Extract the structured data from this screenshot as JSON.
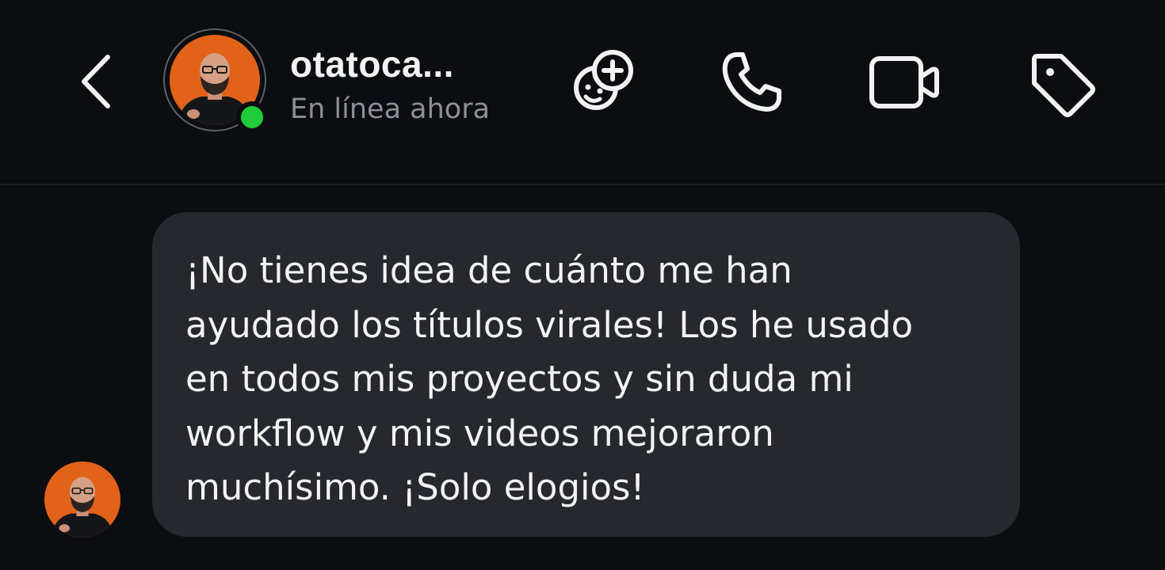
{
  "header": {
    "contact_name": "otatoca...",
    "status": "En línea ahora",
    "icons": {
      "back": "chevron-left-icon",
      "effects": "sticker-add-icon",
      "call": "phone-icon",
      "video": "video-camera-icon",
      "tag": "tag-icon"
    },
    "online_color": "#1fcb38"
  },
  "message": {
    "lines": [
      "¡No tienes idea de cuánto me han",
      "ayudado los títulos virales! Los he usado",
      "en todos mis proyectos y sin duda mi",
      "workflow y mis videos mejoraron",
      "muchísimo. ¡Solo elogios!"
    ]
  },
  "colors": {
    "background": "#0c0d11",
    "bubble": "#27282d",
    "text": "#f3f3f5",
    "status_text": "#8d8f97",
    "avatar_orange": "#e2621a"
  }
}
